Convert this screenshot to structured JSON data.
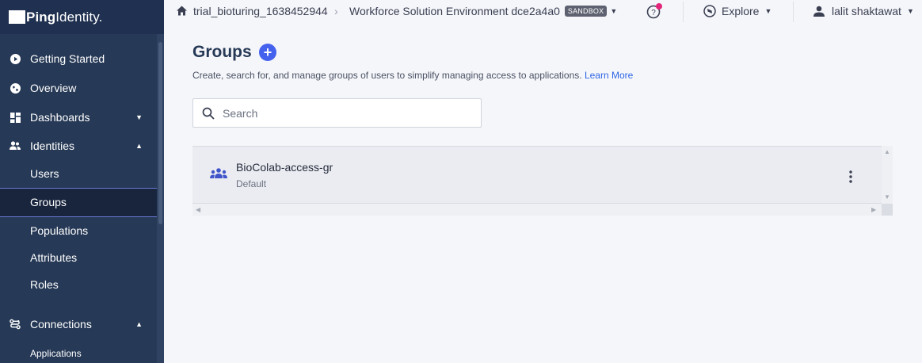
{
  "app": {
    "logo_bold": "Ping",
    "logo_light": "Identity."
  },
  "sidebar": {
    "items": [
      {
        "label": "Getting Started",
        "icon": "play-circle-icon"
      },
      {
        "label": "Overview",
        "icon": "globe-icon"
      },
      {
        "label": "Dashboards",
        "icon": "dashboard-icon",
        "chevron": "down"
      },
      {
        "label": "Identities",
        "icon": "people-icon",
        "chevron": "up"
      },
      {
        "label": "Connections",
        "icon": "connections-icon",
        "chevron": "up"
      }
    ],
    "identities_sub": [
      {
        "label": "Users"
      },
      {
        "label": "Groups",
        "active": true
      },
      {
        "label": "Populations"
      },
      {
        "label": "Attributes"
      },
      {
        "label": "Roles"
      }
    ],
    "connections_sub": [
      {
        "label": "Applications"
      }
    ]
  },
  "topbar": {
    "org": "trial_bioturing_1638452944",
    "separator": "›",
    "environment": "Workforce Solution Environment dce2a4a0",
    "env_badge": "SANDBOX",
    "explore": "Explore",
    "user": "lalit shaktawat",
    "help_notification_color": "#e4267a"
  },
  "main": {
    "title": "Groups",
    "add_symbol": "+",
    "description": "Create, search for, and manage groups of users to simplify managing access to applications.",
    "learn_more": "Learn More",
    "search_placeholder": "Search",
    "groups": [
      {
        "name": "BioColab-access-gr",
        "population": "Default",
        "icon": "group-icon"
      }
    ]
  },
  "colors": {
    "sidebar_bg": "#263956",
    "accent": "#4462ed",
    "link": "#2d65e5"
  }
}
